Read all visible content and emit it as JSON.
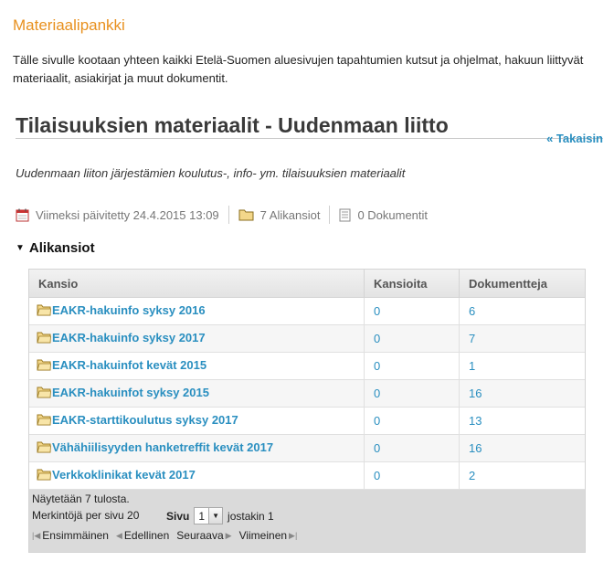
{
  "portal": {
    "title": "Materiaalipankki"
  },
  "intro": "Tälle sivulle kootaan yhteen kaikki Etelä-Suomen aluesivujen tapahtumien kutsut ja ohjelmat, hakuun liittyvät materiaalit, asiakirjat ja muut dokumentit.",
  "page": {
    "title": "Tilaisuuksien materiaalit - Uudenmaan liitto",
    "back_label": "« Takaisin",
    "description": "Uudenmaan liiton järjestämien koulutus-, info- ym. tilaisuuksien materiaalit"
  },
  "meta": {
    "updated": "Viimeksi päivitetty 24.4.2015 13:09",
    "subfolders": "7 Alikansiot",
    "documents": "0 Dokumentit"
  },
  "section": {
    "title": "Alikansiot"
  },
  "table": {
    "columns": [
      "Kansio",
      "Kansioita",
      "Dokumentteja"
    ],
    "rows": [
      {
        "name": "EAKR-hakuinfo syksy 2016",
        "folders": "0",
        "docs": "6"
      },
      {
        "name": "EAKR-hakuinfo syksy 2017",
        "folders": "0",
        "docs": "7"
      },
      {
        "name": "EAKR-hakuinfot kevät 2015",
        "folders": "0",
        "docs": "1"
      },
      {
        "name": "EAKR-hakuinfot syksy 2015",
        "folders": "0",
        "docs": "16"
      },
      {
        "name": "EAKR-starttikoulutus syksy 2017",
        "folders": "0",
        "docs": "13"
      },
      {
        "name": "Vähähiilisyyden hanketreffit kevät 2017",
        "folders": "0",
        "docs": "16"
      },
      {
        "name": "Verkkoklinikat kevät 2017",
        "folders": "0",
        "docs": "2"
      }
    ]
  },
  "footer": {
    "shown": "Näytetään 7 tulosta.",
    "per_page": "Merkintöjä per sivu 20",
    "page_label": "Sivu",
    "page_value": "1",
    "page_of": "jostakin 1",
    "first": "Ensimmäinen",
    "prev": "Edellinen",
    "next": "Seuraava",
    "last": "Viimeinen"
  },
  "colors": {
    "accent_orange": "#e8901e",
    "link_blue": "#2a8fc0"
  }
}
